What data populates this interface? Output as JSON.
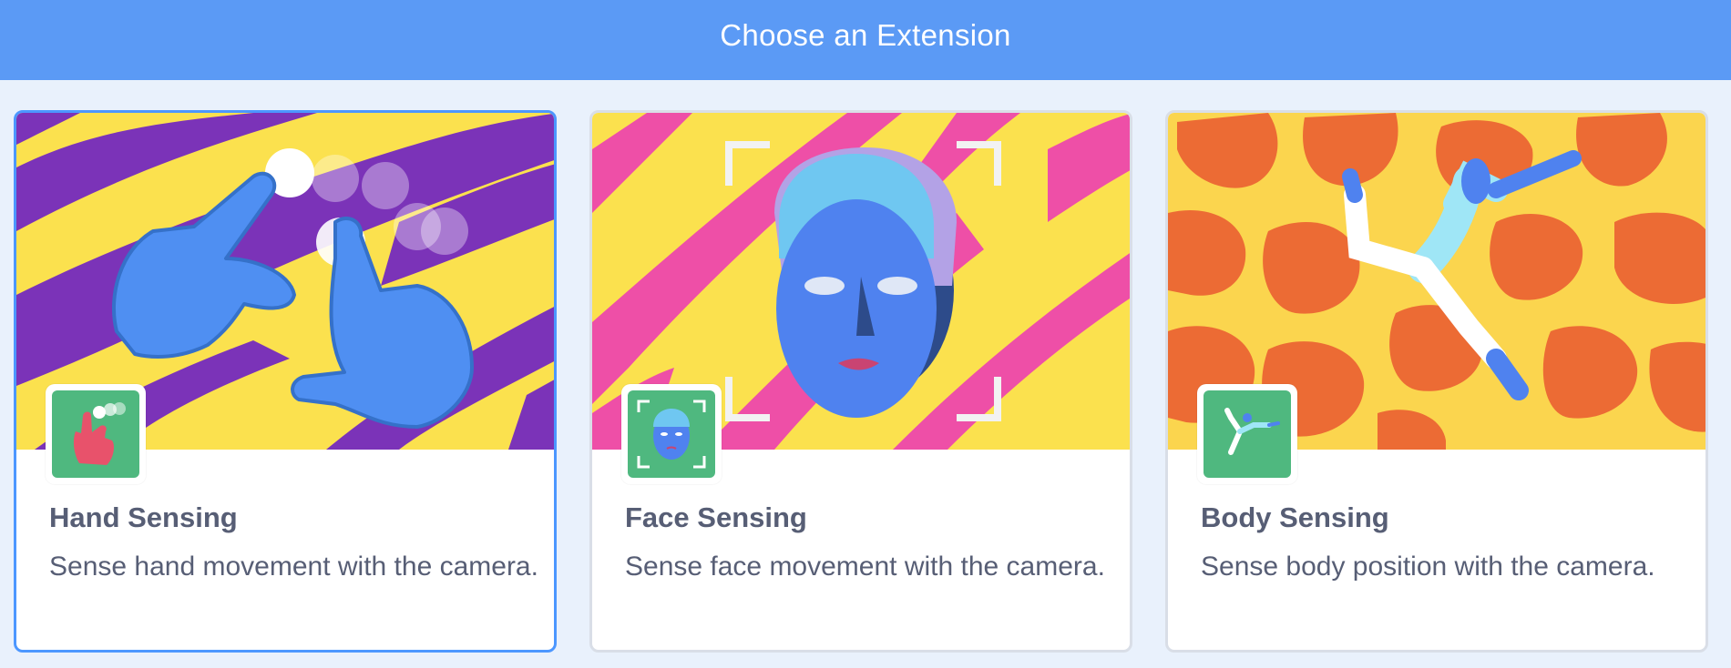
{
  "header": {
    "title": "Choose an Extension"
  },
  "cards": [
    {
      "title": "Hand Sensing",
      "description": "Sense hand movement with the camera.",
      "selected": true,
      "icon": "hand-sensing-icon"
    },
    {
      "title": "Face Sensing",
      "description": "Sense face movement with the camera.",
      "selected": false,
      "icon": "face-sensing-icon"
    },
    {
      "title": "Body Sensing",
      "description": "Sense body position with the camera.",
      "selected": false,
      "icon": "body-sensing-icon"
    }
  ],
  "colors": {
    "header": "#5b9af5",
    "background": "#e9f1fc",
    "selected_border": "#4c97ff",
    "text": "#575e75",
    "icon_bg": "#4fb87f"
  }
}
